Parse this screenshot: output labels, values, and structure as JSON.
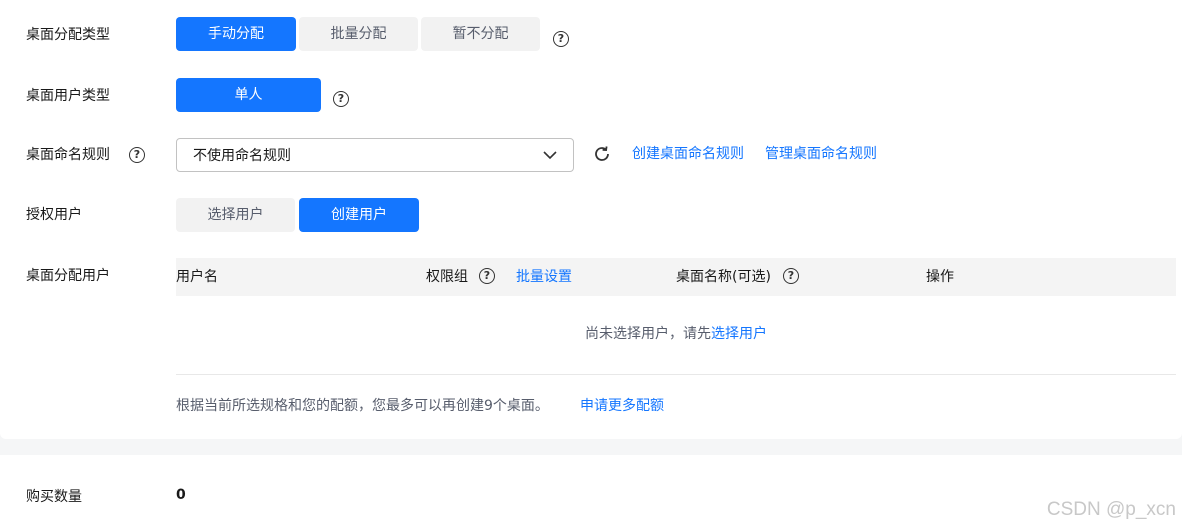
{
  "allocation_type": {
    "label": "桌面分配类型",
    "options": [
      "手动分配",
      "批量分配",
      "暂不分配"
    ],
    "selected": "手动分配"
  },
  "user_type": {
    "label": "桌面用户类型",
    "option": "单人"
  },
  "naming_rule": {
    "label": "桌面命名规则",
    "value": "不使用命名规则",
    "create_link": "创建桌面命名规则",
    "manage_link": "管理桌面命名规则"
  },
  "authorized_users": {
    "label": "授权用户",
    "options": [
      "选择用户",
      "创建用户"
    ],
    "selected": "创建用户"
  },
  "assign_users": {
    "label": "桌面分配用户",
    "columns": {
      "username": "用户名",
      "permission_group": "权限组",
      "batch_settings": "批量设置",
      "desktop_name": "桌面名称(可选)",
      "actions": "操作"
    },
    "empty_prefix": "尚未选择用户，请先",
    "empty_link": "选择用户",
    "quota_note": "根据当前所选规格和您的配额，您最多可以再创建9个桌面。",
    "quota_link": "申请更多配额"
  },
  "purchase": {
    "label": "购买数量",
    "value": "0"
  },
  "watermark": "CSDN @p_xcn",
  "colors": {
    "accent": "#1476ff",
    "inactive_bg": "#f2f2f2",
    "table_header_bg": "#f4f4f4"
  }
}
